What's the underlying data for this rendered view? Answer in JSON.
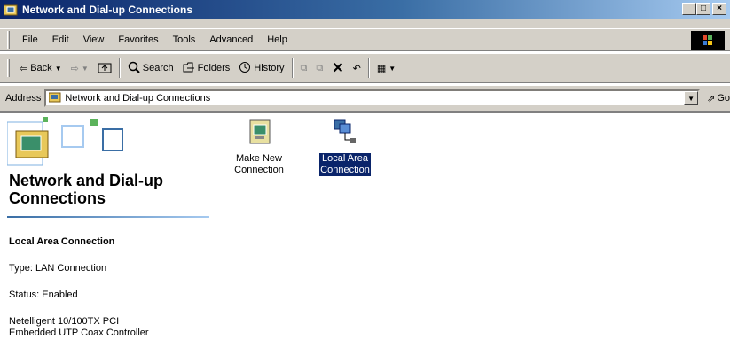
{
  "window": {
    "title": "Network and Dial-up Connections",
    "buttons": [
      "_",
      "□",
      "×"
    ]
  },
  "menu": [
    "File",
    "Edit",
    "View",
    "Favorites",
    "Tools",
    "Advanced",
    "Help"
  ],
  "toolbar": {
    "back": "Back",
    "search": "Search",
    "folders": "Folders",
    "history": "History"
  },
  "address": {
    "label": "Address",
    "value": "Network and Dial-up Connections",
    "go": "Go"
  },
  "left_pane": {
    "title": "Network and Dial-up Connections",
    "selected_name": "Local Area Connection",
    "type": "Type: LAN Connection",
    "status": "Status: Enabled",
    "device_line1": "Netelligent 10/100TX PCI",
    "device_line2": "Embedded UTP Coax Controller"
  },
  "items": [
    {
      "line1": "Make New",
      "line2": "Connection",
      "icon": "make-new-connection-icon",
      "selected": false
    },
    {
      "line1": "Local Area",
      "line2": "Connection",
      "icon": "local-area-connection-icon",
      "selected": true
    }
  ],
  "colors": {
    "title_start": "#0a246a",
    "title_end": "#a6caf0",
    "chrome": "#d4d0c8",
    "selection": "#0a246a"
  }
}
